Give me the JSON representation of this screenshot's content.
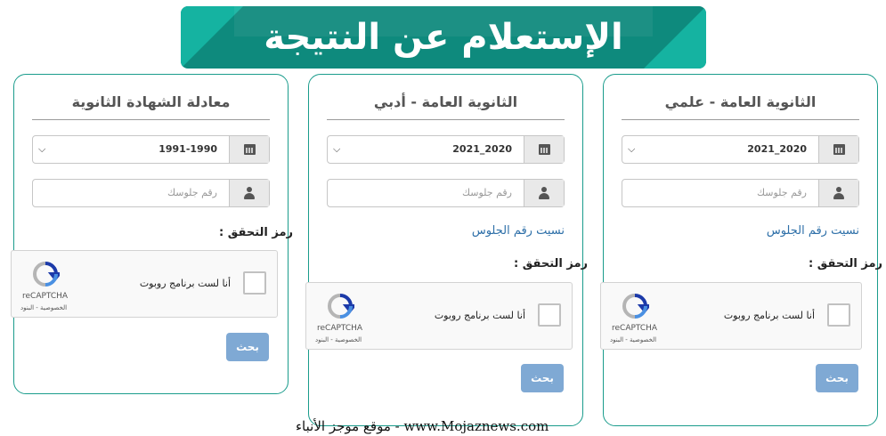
{
  "banner": {
    "title": "الإستعلام عن النتيجة"
  },
  "cards": [
    {
      "title": "الثانوية العامة - علمي",
      "year": "2021_2020",
      "seat_placeholder": "رقم جلوسك",
      "forgot_link": "نسيت رقم الجلوس",
      "captcha_label": "رمز التحقق :",
      "recaptcha": {
        "checkbox_label": "أنا لست برنامج روبوت",
        "brand": "reCAPTCHA",
        "links": "الخصوصية - البنود"
      },
      "search_label": "بحث"
    },
    {
      "title": "الثانوية العامة - أدبي",
      "year": "2021_2020",
      "seat_placeholder": "رقم جلوسك",
      "forgot_link": "نسيت رقم الجلوس",
      "captcha_label": "رمز التحقق :",
      "recaptcha": {
        "checkbox_label": "أنا لست برنامج روبوت",
        "brand": "reCAPTCHA",
        "links": "الخصوصية - البنود"
      },
      "search_label": "بحث"
    },
    {
      "title": "معادلة الشهادة الثانوية",
      "year": "1991-1990",
      "seat_placeholder": "رقم جلوسك",
      "captcha_label": "رمز التحقق :",
      "recaptcha": {
        "checkbox_label": "أنا لست برنامج روبوت",
        "brand": "reCAPTCHA",
        "links": "الخصوصية - البنود"
      },
      "search_label": "بحث"
    }
  ],
  "icons": {
    "year": "calendar-icon",
    "seat": "user-icon",
    "select": "chevron-down-icon",
    "captcha": "recaptcha-logo-icon"
  },
  "colors": {
    "banner": "#0e8a7d",
    "banner_accent": "#15b3a1",
    "card_border": "#1a9c8c",
    "link": "#2d6fa8",
    "button": "#7fa9d4"
  },
  "footer": {
    "text": "موقع موجز الأنباء - www.Mojaznews.com"
  }
}
